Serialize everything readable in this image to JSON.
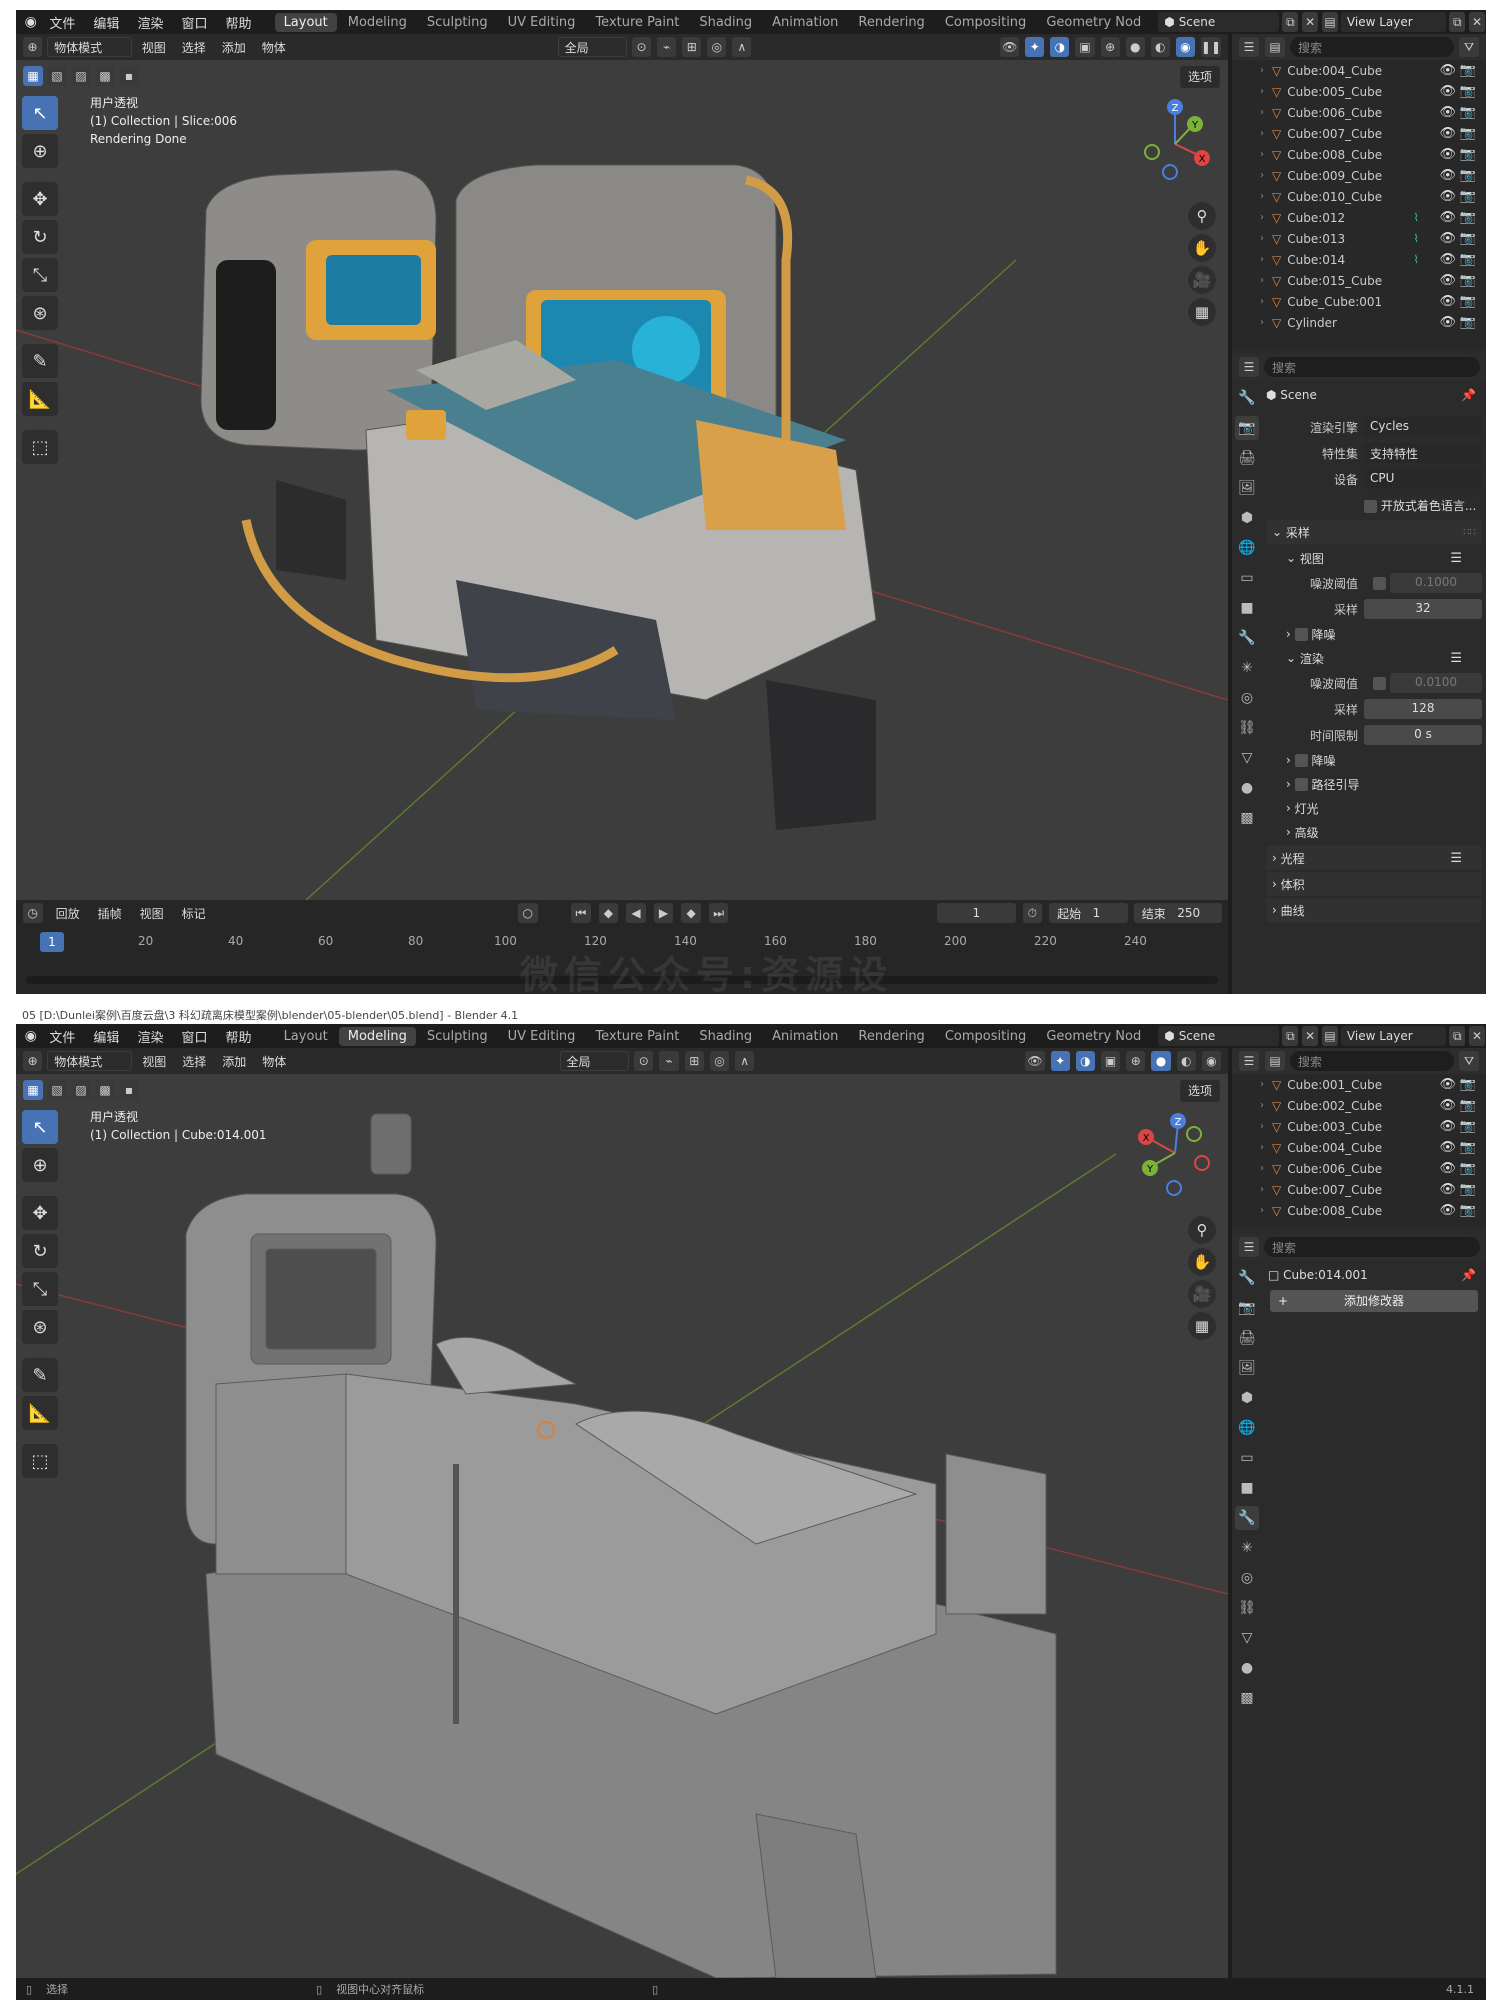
{
  "colors": {
    "accent": "#4772b3",
    "orange_icon": "#e0883f",
    "green_icon": "#39c58a",
    "viewport_bg": "#3d3d3d"
  },
  "menus": [
    "文件",
    "编辑",
    "渲染",
    "窗口",
    "帮助"
  ],
  "workspace_tabs": [
    "Layout",
    "Modeling",
    "Sculpting",
    "UV Editing",
    "Texture Paint",
    "Shading",
    "Animation",
    "Rendering",
    "Compositing",
    "Geometry Nod"
  ],
  "scene_name": "Scene",
  "view_layer": "View Layer",
  "viewport_header": {
    "mode": "物体模式",
    "menus": [
      "视图",
      "选择",
      "添加",
      "物体"
    ],
    "transform_orientation": "全局",
    "select_label": "选项"
  },
  "screen1": {
    "active_tab_index": 0,
    "overlay_lines": [
      "用户透视",
      "(1) Collection | Slice:006",
      "Rendering Done"
    ],
    "outliner_items": [
      {
        "name": "Cube:004_Cube"
      },
      {
        "name": "Cube:005_Cube"
      },
      {
        "name": "Cube:006_Cube"
      },
      {
        "name": "Cube:007_Cube"
      },
      {
        "name": "Cube:008_Cube"
      },
      {
        "name": "Cube:009_Cube"
      },
      {
        "name": "Cube:010_Cube"
      },
      {
        "name": "Cube:012",
        "mod": true
      },
      {
        "name": "Cube:013",
        "mod": true
      },
      {
        "name": "Cube:014",
        "mod": true
      },
      {
        "name": "Cube:015_Cube"
      },
      {
        "name": "Cube_Cube:001"
      },
      {
        "name": "Cylinder",
        "mesh": true
      }
    ],
    "props_search": "搜索",
    "props_title": "Scene",
    "render_engine_label": "渲染引擎",
    "render_engine": "Cycles",
    "feature_set_label": "特性集",
    "feature_set": "支持特性",
    "device_label": "设备",
    "device": "CPU",
    "osl_label": "开放式着色语言...",
    "sampling_label": "采样",
    "viewport_label": "视图",
    "noise_threshold_label": "噪波阈值",
    "viewport_noise": "0.1000",
    "samples_label": "采样",
    "viewport_samples": "32",
    "denoise_label": "降噪",
    "render_label": "渲染",
    "render_noise": "0.0100",
    "render_samples": "128",
    "time_limit_label": "时间限制",
    "time_limit": "0 s",
    "denoise2_label": "降噪",
    "path_guiding_label": "路径引导",
    "lights_label": "灯光",
    "advanced_label": "高级",
    "light_paths_label": "光程",
    "volumes_label": "体积",
    "curves_label": "曲线",
    "timeline": {
      "menus": [
        "回放",
        "插帧",
        "视图",
        "标记"
      ],
      "current_frame": "1",
      "start_label": "起始",
      "start": "1",
      "end_label": "结束",
      "end": "250",
      "ticks": [
        "20",
        "40",
        "60",
        "80",
        "100",
        "120",
        "140",
        "160",
        "180",
        "200",
        "220",
        "240"
      ],
      "playhead": "1"
    }
  },
  "screen2": {
    "titlebar": "05 [D:\\Dunlei案例\\百度云盘\\3 科幻疏离床模型案例\\blender\\05-blender\\05.blend] - Blender 4.1",
    "active_tab_index": 1,
    "overlay_lines": [
      "用户透视",
      "(1) Collection | Cube:014.001"
    ],
    "outliner_items": [
      {
        "name": "Cube:001_Cube"
      },
      {
        "name": "Cube:002_Cube"
      },
      {
        "name": "Cube:003_Cube"
      },
      {
        "name": "Cube:004_Cube"
      },
      {
        "name": "Cube:006_Cube"
      },
      {
        "name": "Cube:007_Cube"
      },
      {
        "name": "Cube:008_Cube"
      }
    ],
    "props_search": "搜索",
    "object_name": "Cube:014.001",
    "add_modifier": "添加修改器",
    "status": [
      "选择",
      "视图中心对齐鼠标"
    ],
    "version": "4.1.1"
  },
  "watermark": "微信公众号:资源设"
}
